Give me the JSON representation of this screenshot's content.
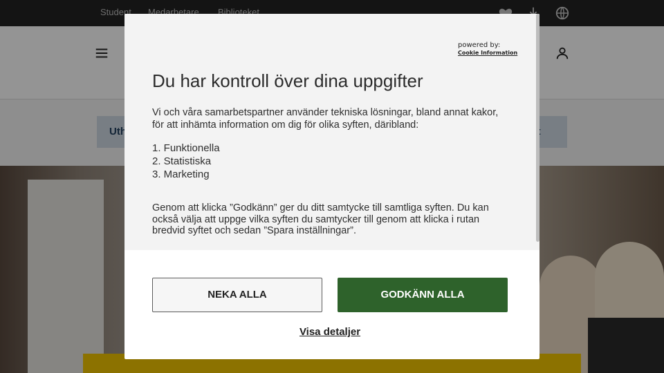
{
  "topbar": {
    "links": [
      "Student",
      "Medarbetare",
      "Biblioteket"
    ],
    "icons": [
      "heart-icon",
      "download-icon",
      "globe-icon"
    ]
  },
  "header": {
    "icons": [
      "hamburger-menu-icon",
      "user-icon"
    ]
  },
  "band": {
    "left_label": "Uth",
    "right_label": "akt"
  },
  "consent": {
    "powered_by": "powered by:",
    "brand": "Cookie Information",
    "title": "Du har kontroll över dina uppgifter",
    "intro": "Vi och våra samarbetspartner använder tekniska lösningar, bland annat kakor, för att inhämta information om dig för olika syften, däribland:",
    "purposes": [
      "1. Funktionella",
      "2. Statistiska",
      "3. Marketing"
    ],
    "explanation": "Genom att klicka ”Godkänn” ger du ditt samtycke till samtliga syften. Du kan också välja att uppge vilka syften du samtycker till genom att klicka i rutan bredvid syftet och sedan ”Spara inställningar”.",
    "deny_label": "NEKA ALLA",
    "accept_label": "GODKÄNN ALLA",
    "details_label": "Visa detaljer",
    "accept_color": "#2e622b"
  }
}
